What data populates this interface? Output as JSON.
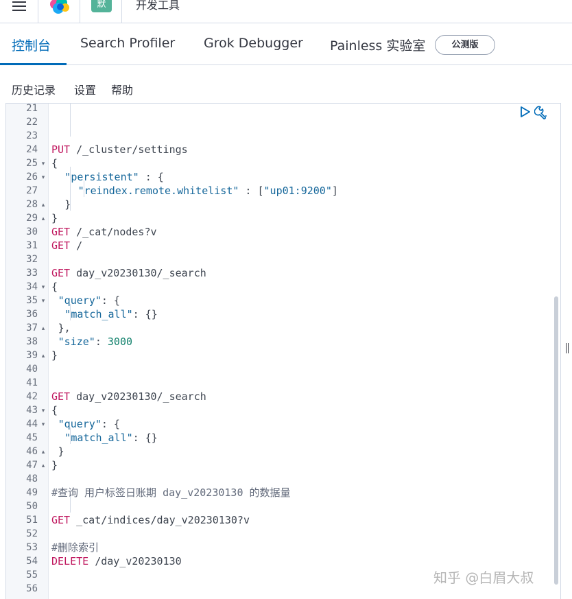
{
  "header": {
    "space_badge": "默",
    "breadcrumb": "开发工具"
  },
  "tabs": {
    "console": "控制台",
    "search_profiler": "Search Profiler",
    "grok_debugger": "Grok Debugger",
    "painless_lab": "Painless 实验室",
    "beta_badge": "公测版",
    "active": "console"
  },
  "toolbar": {
    "history": "历史记录",
    "settings": "设置",
    "help": "帮助"
  },
  "editor": {
    "lines": [
      {
        "num": "21",
        "fold": "",
        "text": ""
      },
      {
        "num": "22",
        "fold": "",
        "text": ""
      },
      {
        "num": "23",
        "fold": "",
        "text": ""
      },
      {
        "num": "24",
        "fold": "",
        "method": "PUT",
        "path": " /_cluster/settings"
      },
      {
        "num": "25",
        "fold": "down",
        "text": "{"
      },
      {
        "num": "26",
        "fold": "down",
        "key": "\"persistent\"",
        "rest": " : {"
      },
      {
        "num": "27",
        "fold": "",
        "key": "\"reindex.remote.whitelist\"",
        "rest": " : [",
        "str": "\"up01:9200\"",
        "tail": "]"
      },
      {
        "num": "28",
        "fold": "up",
        "text": "}"
      },
      {
        "num": "29",
        "fold": "up",
        "text": "}"
      },
      {
        "num": "30",
        "fold": "",
        "method": "GET",
        "path": " /_cat/nodes?v"
      },
      {
        "num": "31",
        "fold": "",
        "method": "GET",
        "path": " /"
      },
      {
        "num": "32",
        "fold": "",
        "text": ""
      },
      {
        "num": "33",
        "fold": "",
        "method": "GET",
        "path": " day_v20230130/_search"
      },
      {
        "num": "34",
        "fold": "down",
        "text": "{"
      },
      {
        "num": "35",
        "fold": "down",
        "key": "\"query\"",
        "rest": ": {"
      },
      {
        "num": "36",
        "fold": "",
        "key": "\"match_all\"",
        "rest": ": {}"
      },
      {
        "num": "37",
        "fold": "up",
        "text": "},"
      },
      {
        "num": "38",
        "fold": "",
        "key": "\"size\"",
        "rest": ": ",
        "number": "3000"
      },
      {
        "num": "39",
        "fold": "up",
        "text": "}"
      },
      {
        "num": "40",
        "fold": "",
        "text": ""
      },
      {
        "num": "41",
        "fold": "",
        "text": ""
      },
      {
        "num": "42",
        "fold": "",
        "method": "GET",
        "path": " day_v20230130/_search"
      },
      {
        "num": "43",
        "fold": "down",
        "text": "{"
      },
      {
        "num": "44",
        "fold": "down",
        "key": "\"query\"",
        "rest": ": {"
      },
      {
        "num": "45",
        "fold": "",
        "key": "\"match_all\"",
        "rest": ": {}"
      },
      {
        "num": "46",
        "fold": "up",
        "text": "}"
      },
      {
        "num": "47",
        "fold": "up",
        "text": "}"
      },
      {
        "num": "48",
        "fold": "",
        "text": ""
      },
      {
        "num": "49",
        "fold": "",
        "comment": "#查询 用户标签日账期 day_v20230130 的数据量"
      },
      {
        "num": "50",
        "fold": "",
        "text": ""
      },
      {
        "num": "51",
        "fold": "",
        "method": "GET",
        "path": " _cat/indices/day_v20230130?v"
      },
      {
        "num": "52",
        "fold": "",
        "text": ""
      },
      {
        "num": "53",
        "fold": "",
        "comment": "#删除索引"
      },
      {
        "num": "54",
        "fold": "",
        "method": "DELETE",
        "path": " /day_v20230130"
      },
      {
        "num": "55",
        "fold": "",
        "text": ""
      },
      {
        "num": "56",
        "fold": "",
        "text": ""
      }
    ]
  },
  "watermark": "知乎 @白眉大叔",
  "colors": {
    "accent": "#006bb8",
    "method": "#c0185f",
    "string": "#14669a",
    "number": "#10806b",
    "badge": "#54b399"
  }
}
